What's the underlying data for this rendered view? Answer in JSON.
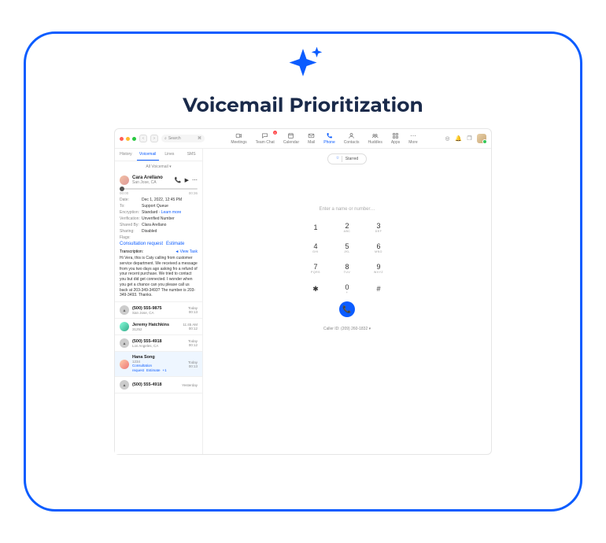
{
  "title": "Voicemail Prioritization",
  "search_placeholder": "Search",
  "nav": {
    "meetings": "Meetings",
    "team_chat": "Team Chat",
    "team_chat_badge": "1",
    "calendar": "Calendar",
    "mail": "Mail",
    "phone": "Phone",
    "contacts": "Contacts",
    "huddles": "Huddles",
    "apps": "Apps",
    "more": "More"
  },
  "subtabs": {
    "history": "History",
    "voicemail": "Voicemail",
    "lines": "Lines",
    "sms": "SMS"
  },
  "vm_filter": "All Voicemail ▾",
  "selected": {
    "name": "Cara Arellano",
    "location": "San Jose, CA",
    "time_start": "00:00",
    "time_end": "00:36",
    "meta": {
      "date_k": "Date:",
      "date_v": "Dec 1, 2022, 12:45 PM",
      "to_k": "To:",
      "to_v": "Support Queue",
      "enc_k": "Encryption:",
      "enc_v": "Standard · ",
      "enc_link": "Learn more",
      "ver_k": "Verification:",
      "ver_v": "Unverified Number",
      "shared_k": "Shared By:",
      "shared_v": "Clara Arellano",
      "sharing_k": "Sharing:",
      "sharing_v": "Disabled",
      "flags_k": "Flags:"
    },
    "flags": {
      "a": "Consultation request",
      "b": "Estimate"
    },
    "trans_label": "Transcription:",
    "view_task": "◄ View Task",
    "trans_body": "Hi Vera, this is Caty calling from customer service department. We received a message from you two days ago asking fro a refund of your recent purchase. We tried to contact you but did get connected. I wonder when you get a chance can you please call us back at 203-349-3493? The number is 203-349-3493. Thanks."
  },
  "rows": [
    {
      "name": "(500) 555-9875",
      "sub": "San Jose, CA",
      "time": "Today",
      "dur": "00:13"
    },
    {
      "name": "Jeremy Hatchkins",
      "sub": "31252",
      "time": "11:45 AM",
      "dur": "00:12"
    },
    {
      "name": "(500) 555-4918",
      "sub": "Los Angeles, CA",
      "time": "Today",
      "dur": "00:12"
    },
    {
      "name": "Hana Song",
      "sub": "1234",
      "time": "Today",
      "dur": "00:13",
      "flags": [
        "Consultation request",
        "Estimate",
        "+1"
      ],
      "sel": true
    },
    {
      "name": "(500) 555-4918",
      "sub": "",
      "time": "Yesterday",
      "dur": ""
    }
  ],
  "star_label": "Starred",
  "entry_placeholder": "Enter a name or number…",
  "dial": {
    "k1_n": "1",
    "k1_l": "",
    "k2_n": "2",
    "k2_l": "ABC",
    "k3_n": "3",
    "k3_l": "DEF",
    "k4_n": "4",
    "k4_l": "GHI",
    "k5_n": "5",
    "k5_l": "JKL",
    "k6_n": "6",
    "k6_l": "MNO",
    "k7_n": "7",
    "k7_l": "PQRS",
    "k8_n": "8",
    "k8_l": "TUV",
    "k9_n": "9",
    "k9_l": "WXYZ",
    "kstar": "✱",
    "k0_n": "0",
    "k0_l": "+",
    "khash": "#"
  },
  "caller_id": "Caller ID: (209) 260-1832 ▾"
}
